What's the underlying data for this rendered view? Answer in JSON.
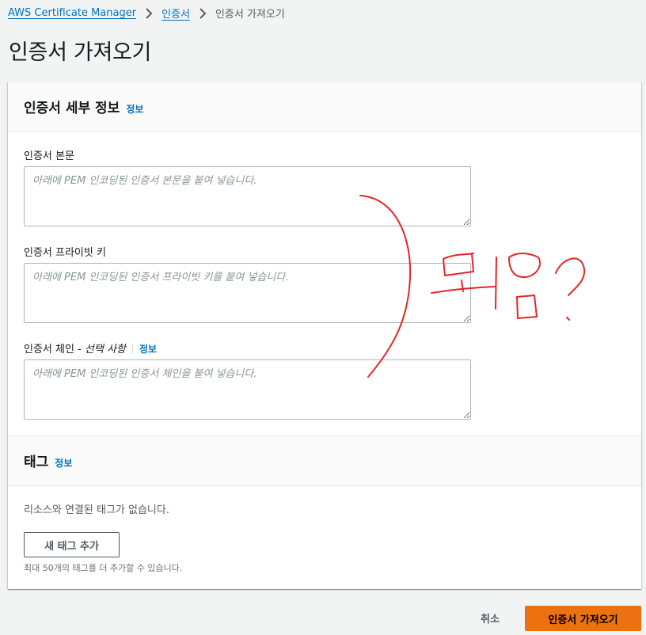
{
  "breadcrumb": {
    "items": [
      "AWS Certificate Manager",
      "인증서"
    ],
    "current": "인증서 가져오기"
  },
  "page_title": "인증서 가져오기",
  "details_section": {
    "title": "인증서 세부 정보",
    "info": "정보",
    "fields": [
      {
        "label": "인증서 본문",
        "placeholder": "아래에 PEM 인코딩된 인증서 본문을 붙여 넣습니다."
      },
      {
        "label": "인증서 프라이빗 키",
        "placeholder": "아래에 PEM 인코딩된 인증서 프라이빗 키를 붙여 넣습니다."
      },
      {
        "label": "인증서 체인 - ",
        "optional": "선택 사항",
        "info": "정보",
        "placeholder": "아래에 PEM 인코딩된 인증서 체인을 붙여 넣습니다."
      }
    ]
  },
  "tags_section": {
    "title": "태그",
    "info": "정보",
    "empty_text": "리소스와 연결된 태그가 없습니다.",
    "add_button": "새 태그 추가",
    "limit_hint": "최대 50개의 태그를 더 추가할 수 있습니다."
  },
  "footer": {
    "cancel": "취소",
    "submit": "인증서 가져오기"
  },
  "annotation": {
    "text": "뭐임?",
    "color": "#e3262a"
  },
  "colors": {
    "link": "#0073bb",
    "primary": "#ec7211",
    "background": "#f2f3f3"
  }
}
